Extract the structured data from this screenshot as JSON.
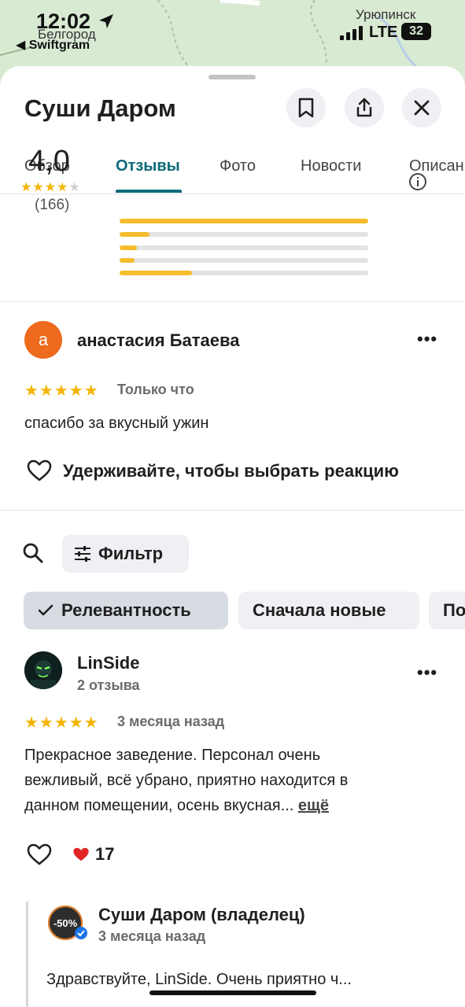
{
  "status_bar": {
    "time": "12:02",
    "network": "LTE",
    "battery": "32",
    "back_app": "◀ Swiftgram",
    "map_cities": [
      "Белгород",
      "Урюпинск"
    ]
  },
  "place": {
    "title": "Суши Даром"
  },
  "header_icons": [
    "bookmark-icon",
    "share-icon",
    "close-icon"
  ],
  "tabs": [
    {
      "label": "Обзор",
      "active": false
    },
    {
      "label": "Отзывы",
      "active": true
    },
    {
      "label": "Фото",
      "active": false
    },
    {
      "label": "Новости",
      "active": false
    },
    {
      "label": "Описание",
      "active": false
    }
  ],
  "rating_summary": {
    "average": "4,0",
    "stars_filled": 4,
    "count": "(166)",
    "distribution": [
      {
        "stars": 5,
        "fraction": 1.0
      },
      {
        "stars": 4,
        "fraction": 0.12
      },
      {
        "stars": 3,
        "fraction": 0.07
      },
      {
        "stars": 2,
        "fraction": 0.06
      },
      {
        "stars": 1,
        "fraction": 0.29
      }
    ]
  },
  "own_review": {
    "avatar_letter": "а",
    "author": "анастасия Батаева",
    "stars": 5,
    "time": "Только что",
    "text": "спасибо за вкусный ужин",
    "reaction_hint": "Удерживайте, чтобы выбрать реакцию"
  },
  "filters": {
    "filter_label": "Фильтр",
    "chips": [
      {
        "label": "Релевантность",
        "selected": true
      },
      {
        "label": "Сначала новые",
        "selected": false
      },
      {
        "label": "По",
        "selected": false
      }
    ]
  },
  "review": {
    "author": "LinSide",
    "subtitle": "2 отзыва",
    "stars": 5,
    "time": "3 месяца назад",
    "text_lines": [
      "Прекрасное заведение. Персонал очень",
      "вежливый, всё убрано, приятно находится в",
      "данном помещении, осень вкусная..."
    ],
    "more_link": "ещё",
    "likes": "17"
  },
  "owner_reply": {
    "author": "Суши Даром (владелец)",
    "time": "3 месяца назад",
    "text": "Здравствуйте, LinSide. Очень приятно ч...",
    "logo_text": "-50%"
  },
  "colors": {
    "accent": "#0b6b7a",
    "star": "#f4b400",
    "bar": "#f6bd2c",
    "avatar_orange": "#ee6a1c",
    "chip_bg": "#eef0f3",
    "chip_selected_bg": "#d7dce2",
    "map": "#d9ead3"
  }
}
